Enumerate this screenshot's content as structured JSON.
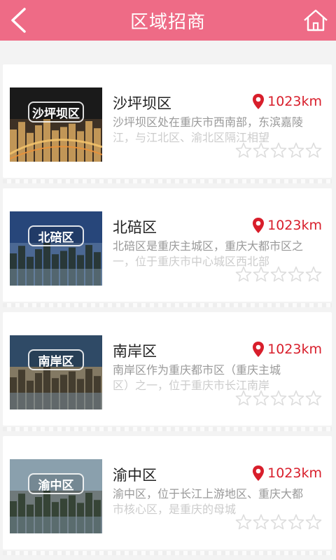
{
  "header": {
    "title": "区域招商",
    "back_icon": "chevron-left-icon",
    "home_icon": "home-icon",
    "color": "#ee6b86"
  },
  "items": [
    {
      "name": "沙坪坝区",
      "badge": "沙坪坝区",
      "distance": "1023km",
      "description": "沙坪坝区处在重庆市西南部，东滨嘉陵",
      "description_line2": "江，与江北区、渝北区隔江相望",
      "rating": 0,
      "image_palette": [
        "#1a1a1a",
        "#5c4630",
        "#d8a860"
      ]
    },
    {
      "name": "北碚区",
      "badge": "北碚区",
      "distance": "1023km",
      "description": "北碚区是重庆主城区，重庆大都市区之",
      "description_line2": "一，位于重庆市中心城区西北部",
      "rating": 0,
      "image_palette": [
        "#27467a",
        "#6a85a8",
        "#233028"
      ]
    },
    {
      "name": "南岸区",
      "badge": "南岸区",
      "distance": "1023km",
      "description": "南岸区作为重庆都市区（重庆主城",
      "description_line2": "区）之一，位于重庆市长江南岸",
      "rating": 0,
      "image_palette": [
        "#2f4a66",
        "#c9a061",
        "#3a3326"
      ]
    },
    {
      "name": "渝中区",
      "badge": "渝中区",
      "distance": "1023km",
      "description": "渝中区，位于长江上游地区、重庆大都",
      "description_line2": "市核心区，是重庆的母城",
      "rating": 0,
      "image_palette": [
        "#8aa0ad",
        "#5a5a50",
        "#2d3b2a"
      ]
    }
  ],
  "colors": {
    "distance": "#d81e2b",
    "star_empty": "#dddddd"
  }
}
